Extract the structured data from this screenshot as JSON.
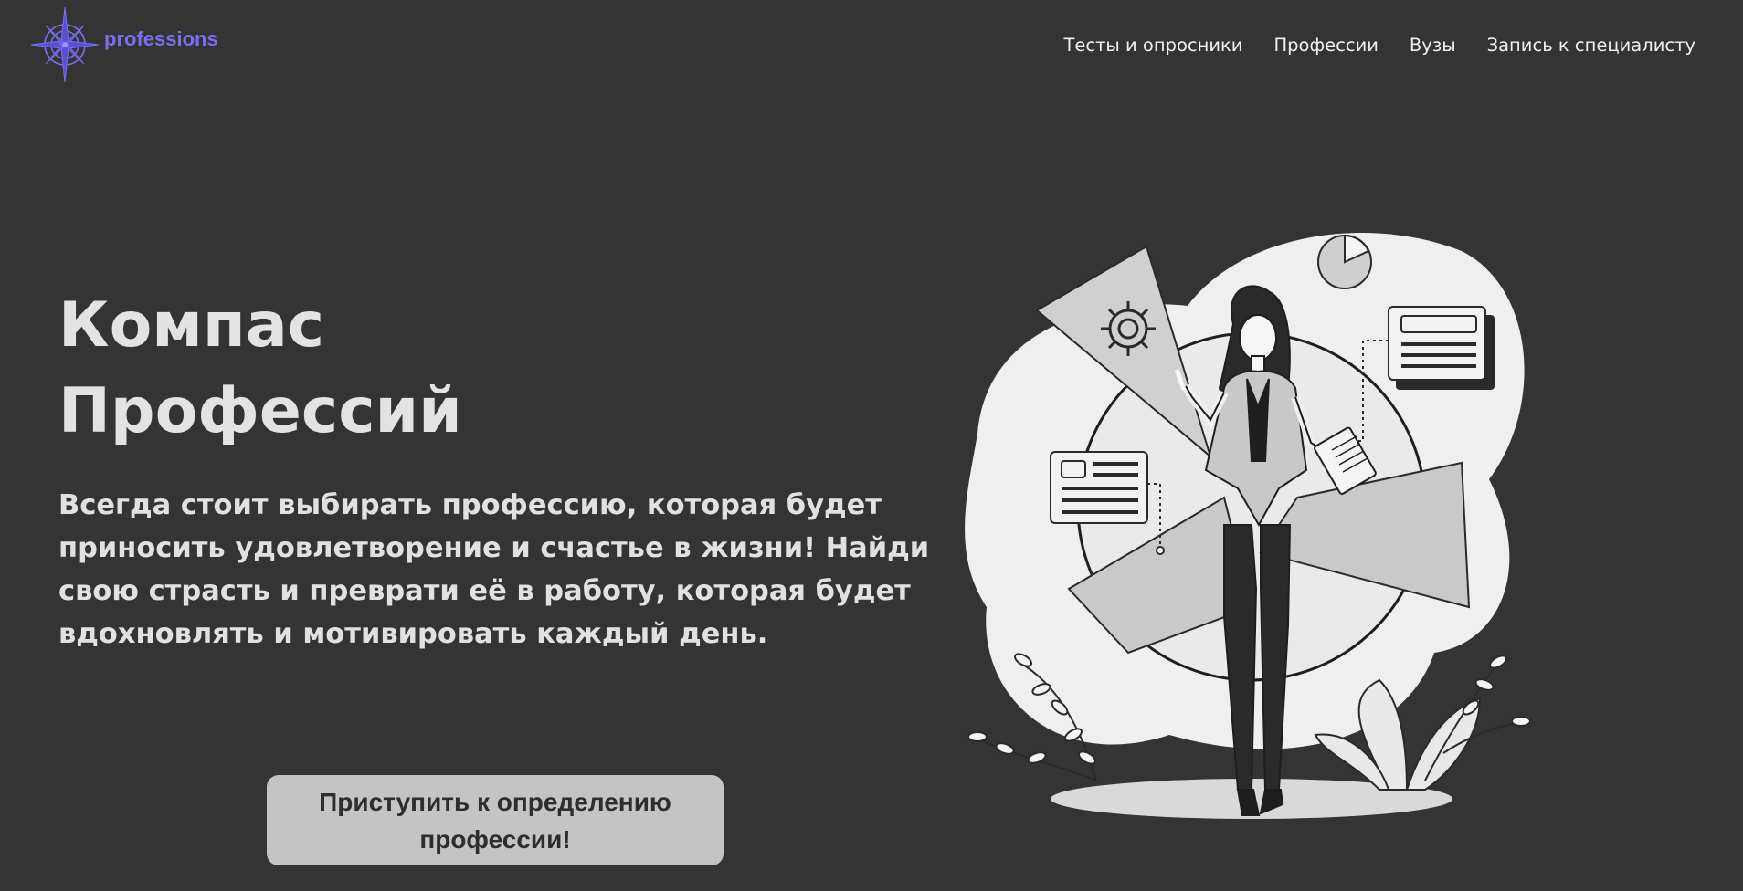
{
  "header": {
    "logo_text": "professions",
    "nav": [
      {
        "label": "Тесты и опросники"
      },
      {
        "label": "Профессии"
      },
      {
        "label": "Вузы"
      },
      {
        "label": "Запись к специалисту"
      }
    ]
  },
  "hero": {
    "title_line1": "Компас",
    "title_line2": "Профессий",
    "text": "Всегда стоит выбирать профессию, которая будет приносить удовлетворение и счастье в жизни! Найди свою страсть и преврати её в работу, которая будет вдохновлять и мотивировать каждый день.",
    "cta_label": "Приступить к определению профессии!"
  },
  "colors": {
    "background": "#343434",
    "brand": "#7b6ef0",
    "nav_text": "#f1f1f1",
    "cta_bg": "#c4c4c4"
  },
  "icons": [
    "compass-logo-icon",
    "gear-icon",
    "pie-chart-icon",
    "card-icon",
    "document-icon"
  ]
}
